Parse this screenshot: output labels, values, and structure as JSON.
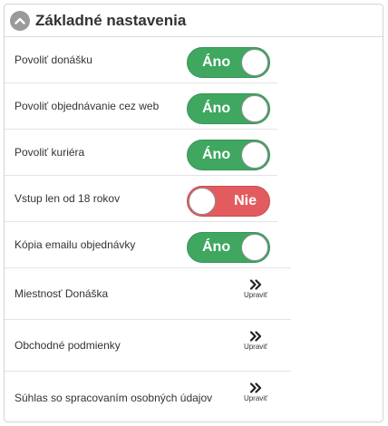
{
  "panel": {
    "title": "Základné nastavenia",
    "collapse_icon": "chevron-up-icon"
  },
  "toggles": [
    {
      "label": "Povoliť donášku",
      "state": "Áno",
      "on": true
    },
    {
      "label": "Povoliť objednávanie cez web",
      "state": "Áno",
      "on": true
    },
    {
      "label": "Povoliť kuriéra",
      "state": "Áno",
      "on": true
    },
    {
      "label": "Vstup len od 18 rokov",
      "state": "Nie",
      "on": false
    },
    {
      "label": "Kópia emailu objednávky",
      "state": "Áno",
      "on": true
    }
  ],
  "links": [
    {
      "label": "Miestnosť Donáška",
      "action": "Upraviť",
      "icon": "double-chevron-right-icon"
    },
    {
      "label": "Obchodné podmienky",
      "action": "Upraviť",
      "icon": "double-chevron-right-icon"
    },
    {
      "label": "Súhlas so spracovaním osobných údajov",
      "action": "Upraviť",
      "icon": "double-chevron-right-icon"
    }
  ],
  "colors": {
    "on": "#3fa760",
    "off": "#e25c5f",
    "header_icon": "#9a9a9a"
  }
}
